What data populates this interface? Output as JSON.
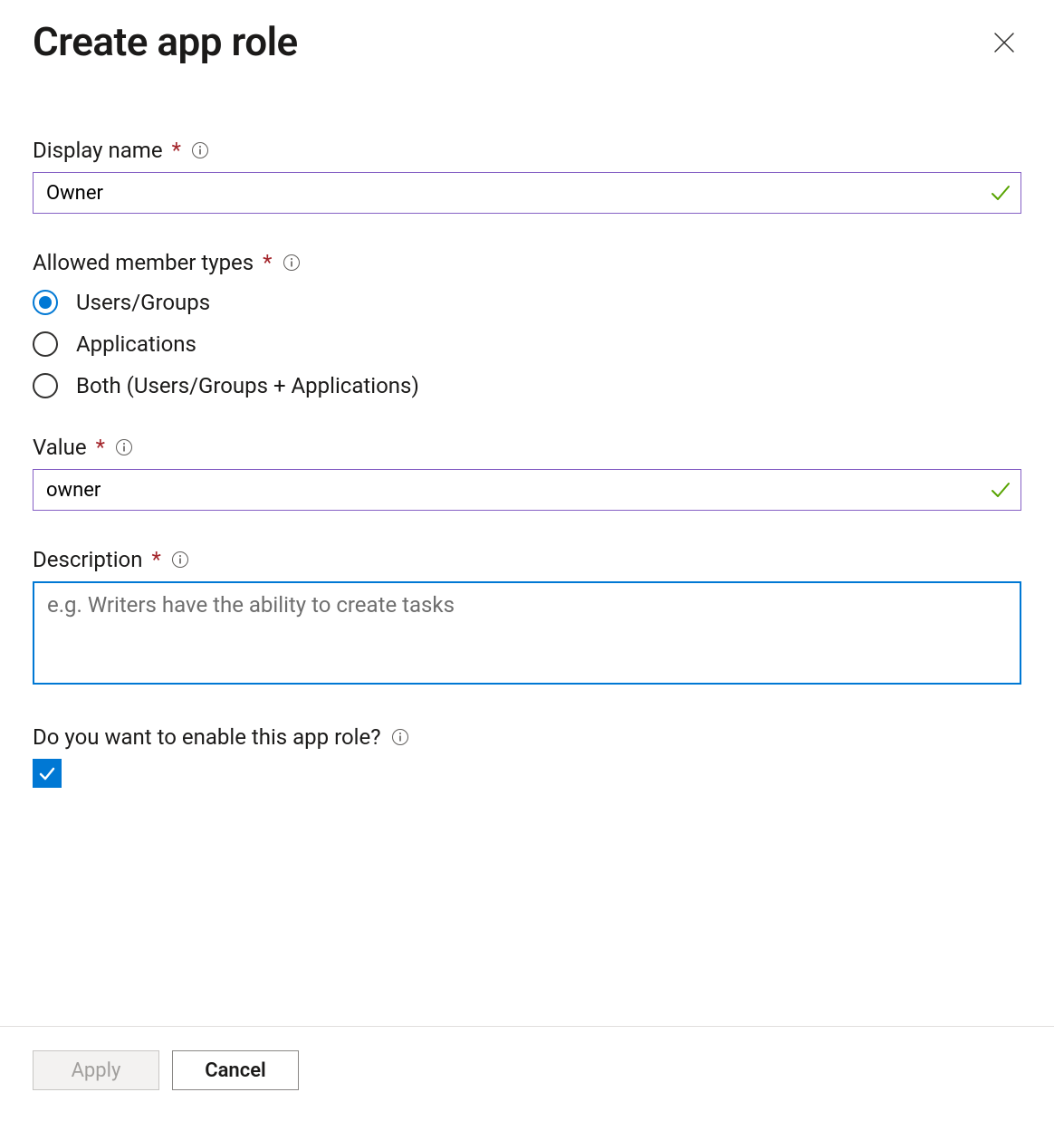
{
  "header": {
    "title": "Create app role"
  },
  "fields": {
    "displayName": {
      "label": "Display name",
      "value": "Owner",
      "required": true
    },
    "allowedMemberTypes": {
      "label": "Allowed member types",
      "required": true,
      "options": [
        {
          "label": "Users/Groups",
          "selected": true
        },
        {
          "label": "Applications",
          "selected": false
        },
        {
          "label": "Both (Users/Groups + Applications)",
          "selected": false
        }
      ]
    },
    "value": {
      "label": "Value",
      "value": "owner",
      "required": true
    },
    "description": {
      "label": "Description",
      "placeholder": "e.g. Writers have the ability to create tasks",
      "value": "",
      "required": true
    },
    "enable": {
      "label": "Do you want to enable this app role?",
      "checked": true
    }
  },
  "footer": {
    "apply": "Apply",
    "cancel": "Cancel"
  }
}
